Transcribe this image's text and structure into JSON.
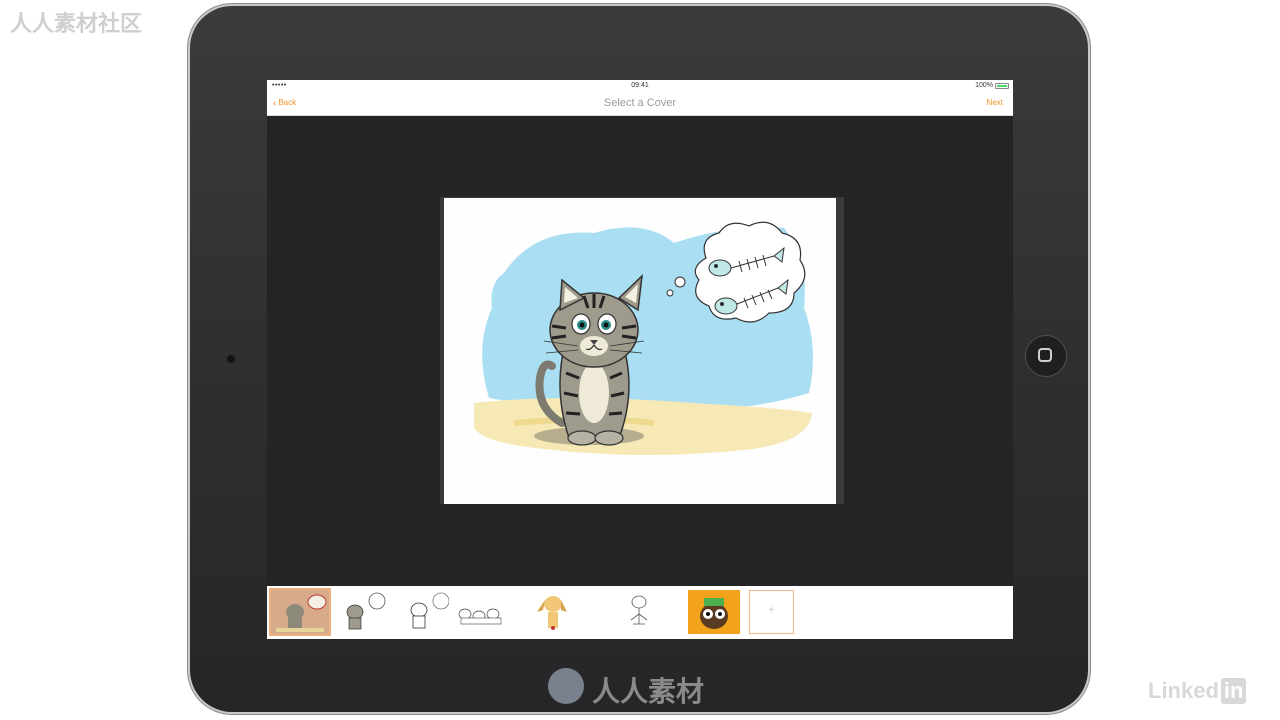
{
  "status_bar": {
    "signal": "•••••",
    "time": "09:41",
    "battery_text": "100%"
  },
  "nav": {
    "back_label": "Back",
    "title": "Select a Cover",
    "next_label": "Next"
  },
  "thumbnails": [
    {
      "name": "cat-with-sign",
      "selected": true
    },
    {
      "name": "cat-with-thought-bubble",
      "selected": false
    },
    {
      "name": "cat-sketch-with-bubble",
      "selected": false
    },
    {
      "name": "cats-sketch-group",
      "selected": false
    },
    {
      "name": "dog",
      "selected": false
    },
    {
      "name": "dog-sketch",
      "selected": false
    },
    {
      "name": "owl-on-orange",
      "selected": false
    }
  ],
  "add_thumbnail_label": "+",
  "watermark": {
    "corner_text": "人人素材社区",
    "center_text": "人人素材",
    "linkedin_text": "Linked",
    "linkedin_in": "in"
  },
  "colors": {
    "accent": "#f0932b",
    "device_bezel": "#2e2e30",
    "canvas_background": "#242325"
  }
}
